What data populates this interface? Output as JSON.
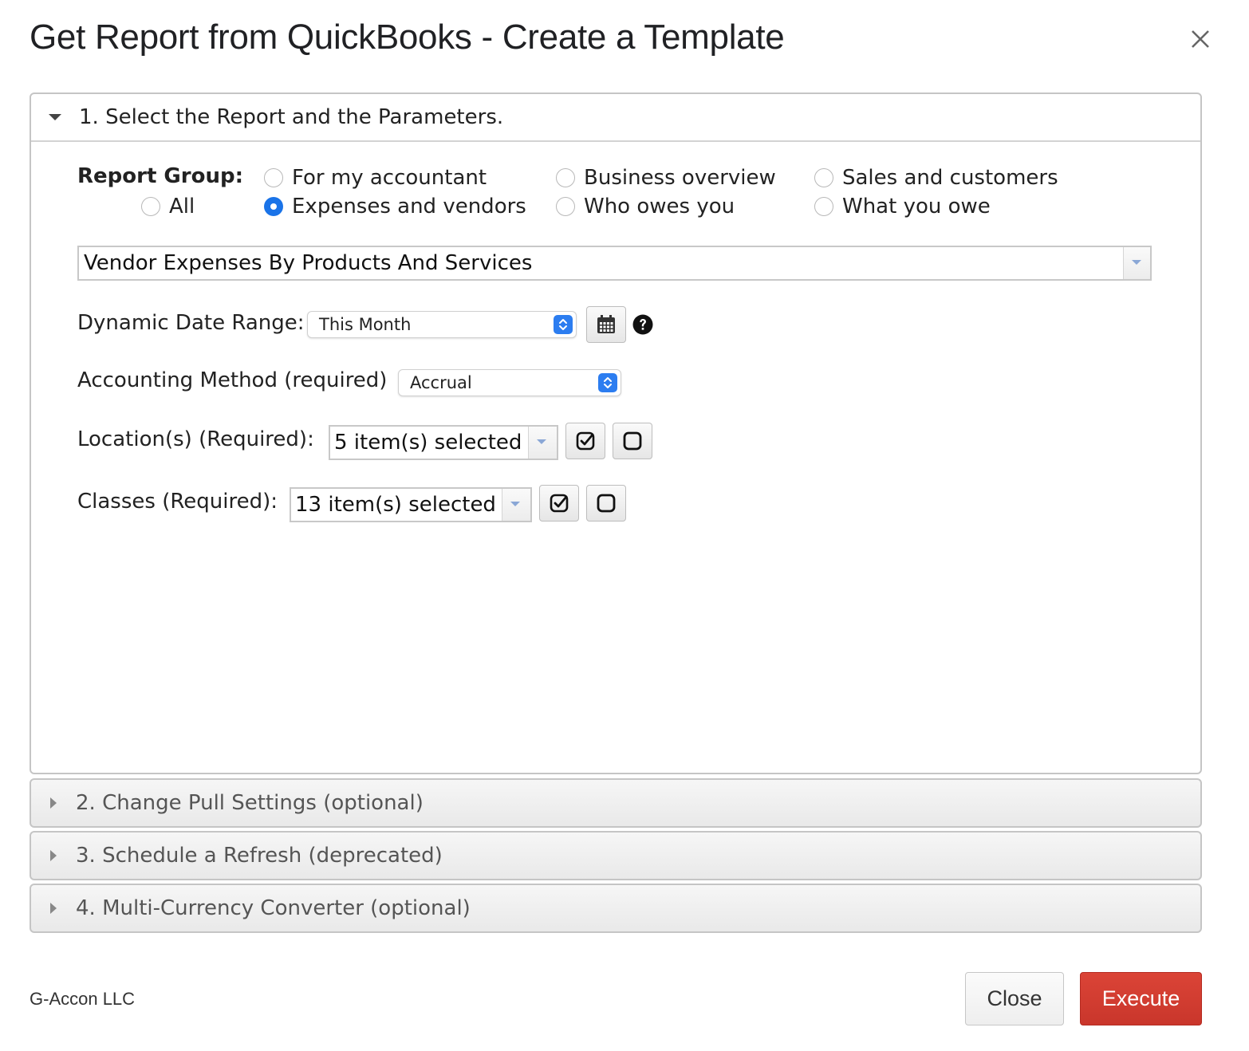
{
  "dialog": {
    "title": "Get Report from QuickBooks - Create a Template",
    "close_icon": "close-icon"
  },
  "sections": [
    {
      "label": "1. Select the Report and the Parameters.",
      "expanded": true
    },
    {
      "label": "2. Change Pull Settings (optional)",
      "expanded": false
    },
    {
      "label": "3. Schedule a Refresh (deprecated)",
      "expanded": false
    },
    {
      "label": "4. Multi-Currency Converter (optional)",
      "expanded": false
    }
  ],
  "report_group": {
    "label": "Report Group:",
    "options": [
      {
        "label": "For my accountant",
        "checked": false
      },
      {
        "label": "Business overview",
        "checked": false
      },
      {
        "label": "Sales and customers",
        "checked": false
      },
      {
        "label": "All",
        "checked": false
      },
      {
        "label": "Expenses and vendors",
        "checked": true
      },
      {
        "label": "Who owes you",
        "checked": false
      },
      {
        "label": "What you owe",
        "checked": false
      }
    ]
  },
  "report_select": {
    "value": "Vendor Expenses By Products And Services"
  },
  "date_range": {
    "label": "Dynamic Date Range:",
    "value": "This Month",
    "calendar_icon": "calendar-icon",
    "help_icon": "help-icon"
  },
  "accounting_method": {
    "label": "Accounting Method (required)",
    "value": "Accrual"
  },
  "locations": {
    "label": "Location(s) (Required):",
    "value": "5 item(s) selected"
  },
  "classes": {
    "label": "Classes (Required):",
    "value": "13 item(s) selected"
  },
  "footer": {
    "company": "G-Accon LLC",
    "close_label": "Close",
    "execute_label": "Execute"
  },
  "colors": {
    "accent_blue": "#1a73e8",
    "execute_red": "#d23f31"
  }
}
